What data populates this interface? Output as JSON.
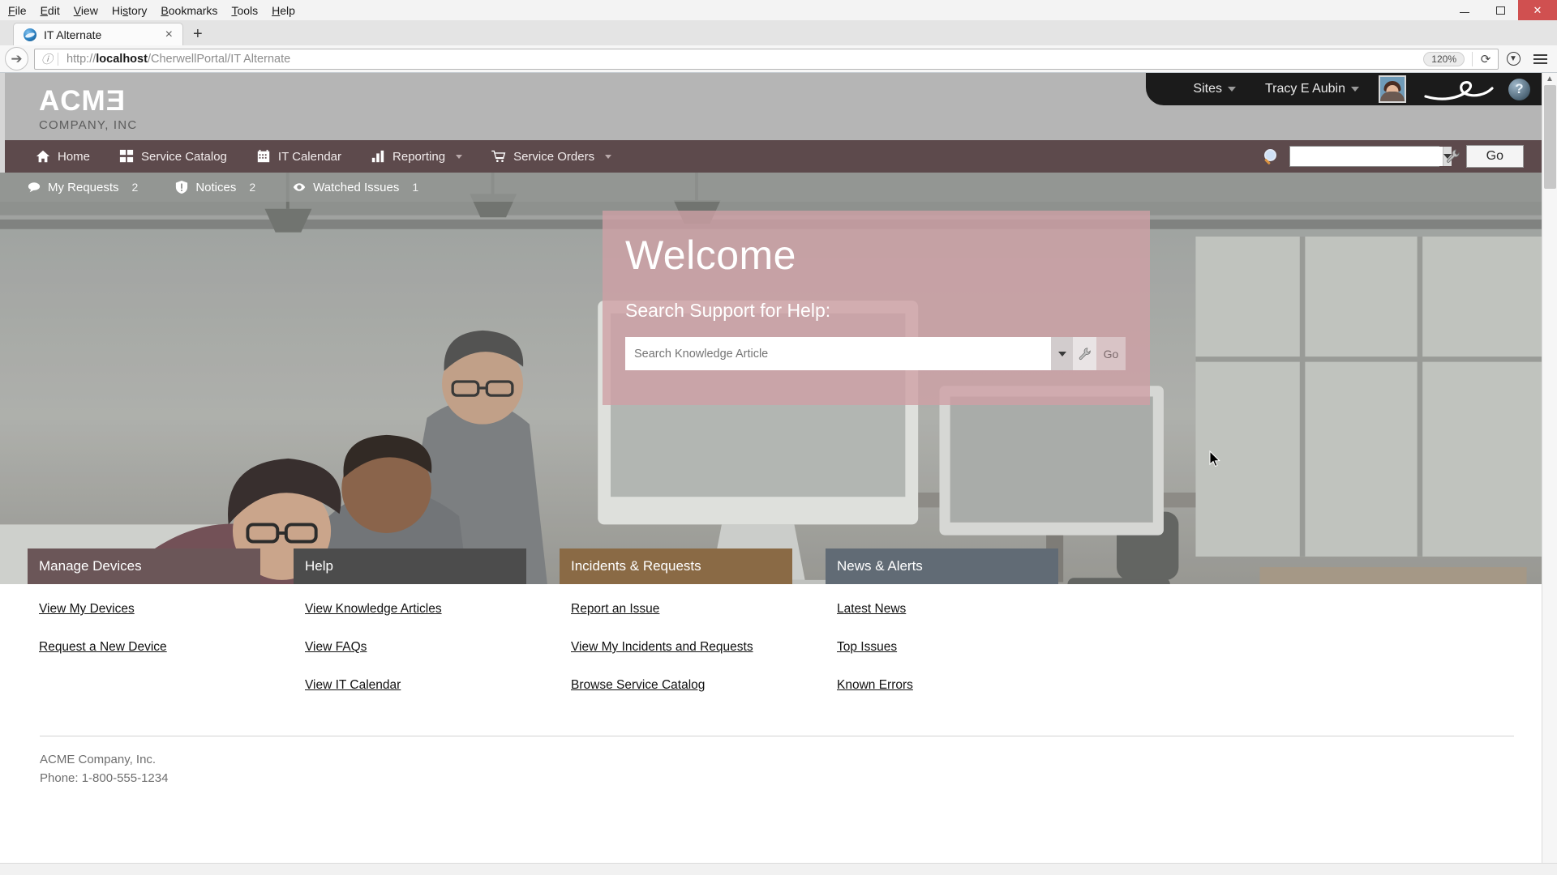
{
  "browser": {
    "menus": [
      "File",
      "Edit",
      "View",
      "History",
      "Bookmarks",
      "Tools",
      "Help"
    ],
    "tab": {
      "title": "IT Alternate",
      "close_label": "×",
      "new_tab_label": "+"
    },
    "url": {
      "scheme": "http://",
      "host": "localhost",
      "path": "/CherwellPortal/IT Alternate"
    },
    "zoom_level": "120%",
    "reload_label": "⟳",
    "window_controls": {
      "minimize": "–",
      "maximize": "▫",
      "close": "×"
    }
  },
  "header": {
    "logo_main": "ACMƎ",
    "logo_sub": "COMPANY, INC",
    "sites_label": "Sites",
    "user_name": "Tracy E Aubin",
    "help_label": "?"
  },
  "mainnav": {
    "items": [
      {
        "label": "Home",
        "icon": "home-icon",
        "caret": false
      },
      {
        "label": "Service Catalog",
        "icon": "grid-icon",
        "caret": false
      },
      {
        "label": "IT Calendar",
        "icon": "calendar-icon",
        "caret": false
      },
      {
        "label": "Reporting",
        "icon": "bar-chart-icon",
        "caret": true
      },
      {
        "label": "Service Orders",
        "icon": "cart-icon",
        "caret": true
      }
    ],
    "search_value": "",
    "search_placeholder": "",
    "go_label": "Go"
  },
  "subnav": {
    "items": [
      {
        "label": "My Requests",
        "count": "2",
        "icon": "comment-icon"
      },
      {
        "label": "Notices",
        "count": "2",
        "icon": "shield-alert-icon"
      },
      {
        "label": "Watched Issues",
        "count": "1",
        "icon": "eye-icon"
      }
    ]
  },
  "hero": {
    "title": "Welcome",
    "subtitle": "Search Support for Help:",
    "search_value": "",
    "search_placeholder": "Search Knowledge Article",
    "go_label": "Go"
  },
  "panels": [
    {
      "title": "Manage Devices",
      "color": "#6b5658",
      "links": [
        "View My Devices",
        "Request a New Device"
      ]
    },
    {
      "title": "Help",
      "color": "#4c4c4c",
      "links": [
        "View Knowledge Articles",
        "View FAQs",
        "View IT Calendar"
      ]
    },
    {
      "title": "Incidents & Requests",
      "color": "#8a6a45",
      "links": [
        "Report an Issue",
        "View My Incidents and Requests",
        "Browse Service Catalog"
      ]
    },
    {
      "title": "News & Alerts",
      "color": "#616b75",
      "links": [
        "Latest News",
        "Top Issues",
        "Known Errors"
      ]
    }
  ],
  "footer": {
    "company": "ACME Company, Inc.",
    "phone": "Phone: 1-800-555-1234"
  },
  "theme": {
    "nav_bar": "#5d4a4c",
    "header_bg": "#b5b5b5",
    "user_bar": "#1b1b1b",
    "welcome_card": "rgba(206,160,165,0.80)"
  }
}
